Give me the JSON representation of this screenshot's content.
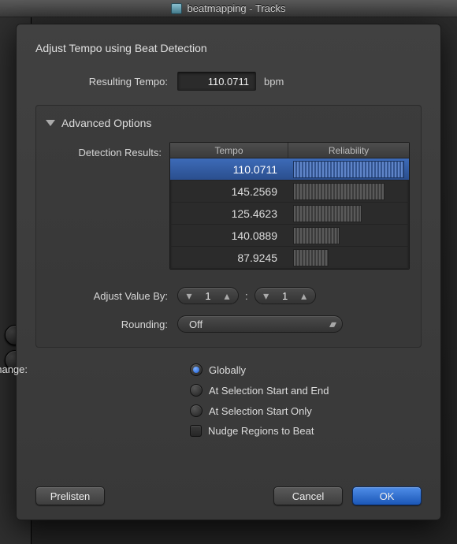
{
  "window": {
    "title": "beatmapping - Tracks"
  },
  "dialog": {
    "title": "Adjust Tempo using Beat Detection",
    "resulting_tempo_label": "Resulting Tempo:",
    "resulting_tempo_value": "110.0711",
    "bpm_unit": "bpm",
    "advanced_title": "Advanced Options",
    "detection_results_label": "Detection Results:",
    "columns": {
      "tempo": "Tempo",
      "reliability": "Reliability"
    },
    "results": [
      {
        "tempo": "110.0711",
        "reliability": 100,
        "selected": true
      },
      {
        "tempo": "145.2569",
        "reliability": 82,
        "selected": false
      },
      {
        "tempo": "125.4623",
        "reliability": 62,
        "selected": false
      },
      {
        "tempo": "140.0889",
        "reliability": 42,
        "selected": false
      },
      {
        "tempo": "87.9245",
        "reliability": 32,
        "selected": false
      }
    ],
    "adjust_label": "Adjust Value By:",
    "adjust_num": "1",
    "adjust_den": "1",
    "rounding_label": "Rounding:",
    "rounding_value": "Off",
    "create_label": "Create Tempo Change:",
    "options": {
      "globally": "Globally",
      "start_end": "At Selection Start and End",
      "start_only": "At Selection Start Only",
      "nudge": "Nudge Regions to Beat"
    },
    "buttons": {
      "prelisten": "Prelisten",
      "cancel": "Cancel",
      "ok": "OK"
    }
  }
}
